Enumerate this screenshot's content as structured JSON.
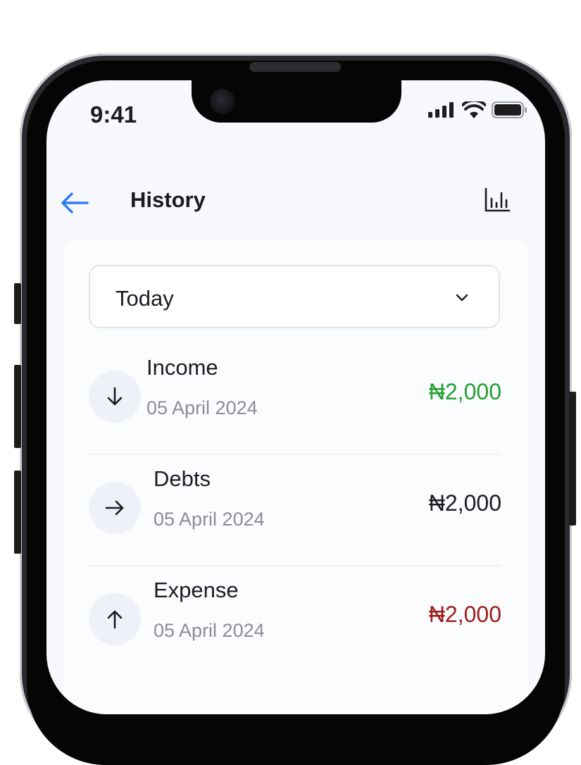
{
  "status_bar": {
    "time": "9:41"
  },
  "header": {
    "title": "History"
  },
  "filter": {
    "selected": "Today"
  },
  "currency_symbol": "₦",
  "transactions": [
    {
      "name": "Income",
      "date": "05 April 2024",
      "amount": "2,000",
      "color": "#22a033",
      "icon": "arrow-down-icon"
    },
    {
      "name": "Debts",
      "date": "05 April 2024",
      "amount": "2,000",
      "color": "#1b1c22",
      "icon": "arrow-right-icon"
    },
    {
      "name": "Expense",
      "date": "05 April 2024",
      "amount": "2,000",
      "color": "#9b1c1c",
      "icon": "arrow-up-icon"
    }
  ],
  "colors": {
    "accent": "#2f7cf6",
    "income": "#22a033",
    "expense": "#9b1c1c"
  }
}
